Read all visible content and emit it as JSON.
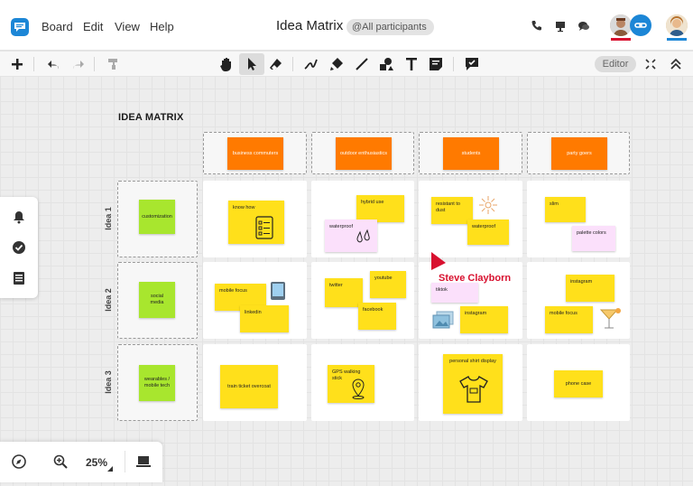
{
  "header": {
    "menu": [
      "Board",
      "Edit",
      "View",
      "Help"
    ],
    "title": "Idea Matrix",
    "participants_label": "@All participants",
    "icons": [
      "phone-icon",
      "presentation-icon",
      "chat-icon",
      "link-icon"
    ]
  },
  "toolbar": {
    "editor_label": "Editor",
    "tools": [
      "add",
      "undo",
      "redo",
      "format-painter",
      "hand",
      "select",
      "eraser",
      "pen",
      "highlighter",
      "line",
      "shapes",
      "text",
      "sticky-note",
      "comment"
    ]
  },
  "left_panel": {
    "icons": [
      "bell-icon",
      "check-icon",
      "list-icon"
    ]
  },
  "bottom_bar": {
    "zoom": "25%",
    "icons": [
      "compass-icon",
      "zoom-in-icon",
      "laptop-icon"
    ]
  },
  "colors": {
    "accent": "#1c86d6",
    "sticky_yellow": "#ffe01b",
    "sticky_orange": "#ff7a00",
    "sticky_green": "#a8e62e",
    "sticky_pink": "#fbe0fb",
    "cursor": "#d8112f"
  },
  "board": {
    "title": "IDEA MATRIX",
    "columns": [
      "business commuters",
      "outdoor enthusiastics",
      "students",
      "party goers"
    ],
    "rows": [
      {
        "label": "Idea 1",
        "idea": "customization",
        "cells": [
          [
            "know how"
          ],
          [
            "hybrid use",
            "waterproof"
          ],
          [
            "resistant to dust",
            "waterproof"
          ],
          [
            "slim",
            "palette colors"
          ]
        ]
      },
      {
        "label": "Idea 2",
        "idea": "social media",
        "cells": [
          [
            "mobile focus",
            "linkedin"
          ],
          [
            "twitter",
            "youtube",
            "facebook"
          ],
          [
            "tiktok",
            "instagram"
          ],
          [
            "instagram",
            "mobile focus"
          ]
        ]
      },
      {
        "label": "Idea 3",
        "idea": "wearables / mobile tech",
        "cells": [
          [
            "train ticket overcoat"
          ],
          [
            "GPS walking stick"
          ],
          [
            "personal shirt display"
          ],
          [
            "phone case"
          ]
        ]
      }
    ]
  },
  "cursor": {
    "name": "Steve Clayborn"
  }
}
